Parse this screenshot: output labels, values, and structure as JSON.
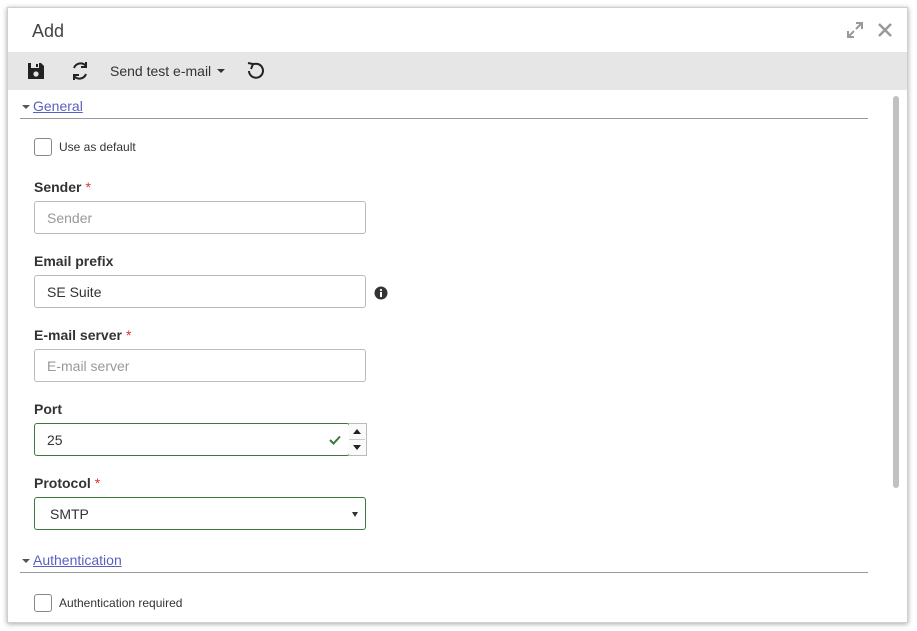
{
  "dialog": {
    "title": "Add",
    "expand_icon": "expand-icon",
    "close_icon": "close-icon"
  },
  "toolbar": {
    "save_icon": "save-icon",
    "refresh_icon": "refresh-icon",
    "send_test_label": "Send test e-mail",
    "reset_icon": "undo-icon"
  },
  "sections": {
    "general": {
      "label": "General",
      "use_default_label": "Use as default",
      "sender": {
        "label": "Sender",
        "required": "*",
        "value": "",
        "placeholder": "Sender"
      },
      "email_prefix": {
        "label": "Email prefix",
        "value": "SE Suite",
        "placeholder": ""
      },
      "email_server": {
        "label": "E-mail server",
        "required": "*",
        "value": "",
        "placeholder": "E-mail server"
      },
      "port": {
        "label": "Port",
        "value": "25"
      },
      "protocol": {
        "label": "Protocol",
        "required": "*",
        "value": "SMTP"
      }
    },
    "authentication": {
      "label": "Authentication",
      "auth_required_label": "Authentication required"
    }
  },
  "colors": {
    "accent_link": "#5a5fbf",
    "valid_border": "#3b7a3b",
    "required_mark": "#dd3333",
    "toolbar_bg": "#e6e6e6"
  }
}
